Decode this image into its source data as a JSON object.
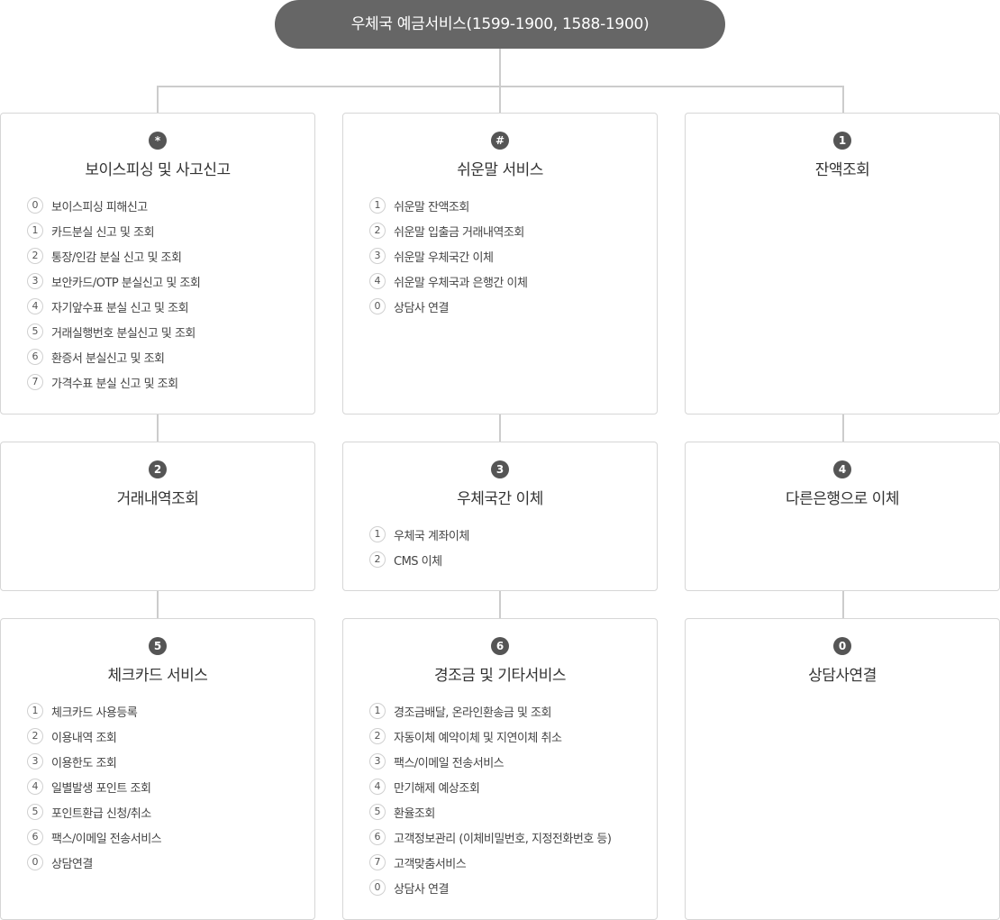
{
  "root": {
    "title": "우체국 예금서비스(1599-1900, 1588-1900)"
  },
  "boxes": [
    {
      "key": "*",
      "title": "보이스피싱 및 사고신고",
      "items": [
        {
          "num": "0",
          "label": "보이스피싱 피해신고"
        },
        {
          "num": "1",
          "label": "카드분실 신고 및 조회"
        },
        {
          "num": "2",
          "label": "통장/인감 분실 신고 및 조회"
        },
        {
          "num": "3",
          "label": "보안카드/OTP 분실신고 및 조회"
        },
        {
          "num": "4",
          "label": "자기앞수표 분실 신고 및 조회"
        },
        {
          "num": "5",
          "label": "거래실행번호 분실신고 및 조회"
        },
        {
          "num": "6",
          "label": "환증서 분실신고 및 조회"
        },
        {
          "num": "7",
          "label": "가격수표 분실 신고 및 조회"
        }
      ]
    },
    {
      "key": "#",
      "title": "쉬운말 서비스",
      "items": [
        {
          "num": "1",
          "label": "쉬운말 잔액조회"
        },
        {
          "num": "2",
          "label": "쉬운말 입출금 거래내역조회"
        },
        {
          "num": "3",
          "label": "쉬운말 우체국간 이체"
        },
        {
          "num": "4",
          "label": "쉬운말 우체국과 은행간 이체"
        },
        {
          "num": "0",
          "label": "상담사 연결"
        }
      ]
    },
    {
      "key": "1",
      "title": "잔액조회",
      "items": []
    },
    {
      "key": "2",
      "title": "거래내역조회",
      "items": []
    },
    {
      "key": "3",
      "title": "우체국간 이체",
      "items": [
        {
          "num": "1",
          "label": "우체국 계좌이체"
        },
        {
          "num": "2",
          "label": "CMS 이체"
        }
      ]
    },
    {
      "key": "4",
      "title": "다른은행으로 이체",
      "items": []
    },
    {
      "key": "5",
      "title": "체크카드 서비스",
      "items": [
        {
          "num": "1",
          "label": "체크카드 사용등록"
        },
        {
          "num": "2",
          "label": "이용내역 조회"
        },
        {
          "num": "3",
          "label": "이용한도 조회"
        },
        {
          "num": "4",
          "label": "일별발생 포인트 조회"
        },
        {
          "num": "5",
          "label": "포인트환급 신청/취소"
        },
        {
          "num": "6",
          "label": "팩스/이메일 전송서비스"
        },
        {
          "num": "0",
          "label": "상담연결"
        }
      ]
    },
    {
      "key": "6",
      "title": "경조금 및 기타서비스",
      "items": [
        {
          "num": "1",
          "label": "경조금배달, 온라인환송금 및 조회"
        },
        {
          "num": "2",
          "label": "자동이체 예약이체 및 지연이체 취소"
        },
        {
          "num": "3",
          "label": "팩스/이메일 전송서비스"
        },
        {
          "num": "4",
          "label": "만기해제 예상조회"
        },
        {
          "num": "5",
          "label": "환율조회"
        },
        {
          "num": "6",
          "label": "고객정보관리 (이체비밀번호, 지정전화번호 등)"
        },
        {
          "num": "7",
          "label": "고객맞춤서비스"
        },
        {
          "num": "0",
          "label": "상담사 연결"
        }
      ]
    },
    {
      "key": "0",
      "title": "상담사연결",
      "items": []
    }
  ]
}
